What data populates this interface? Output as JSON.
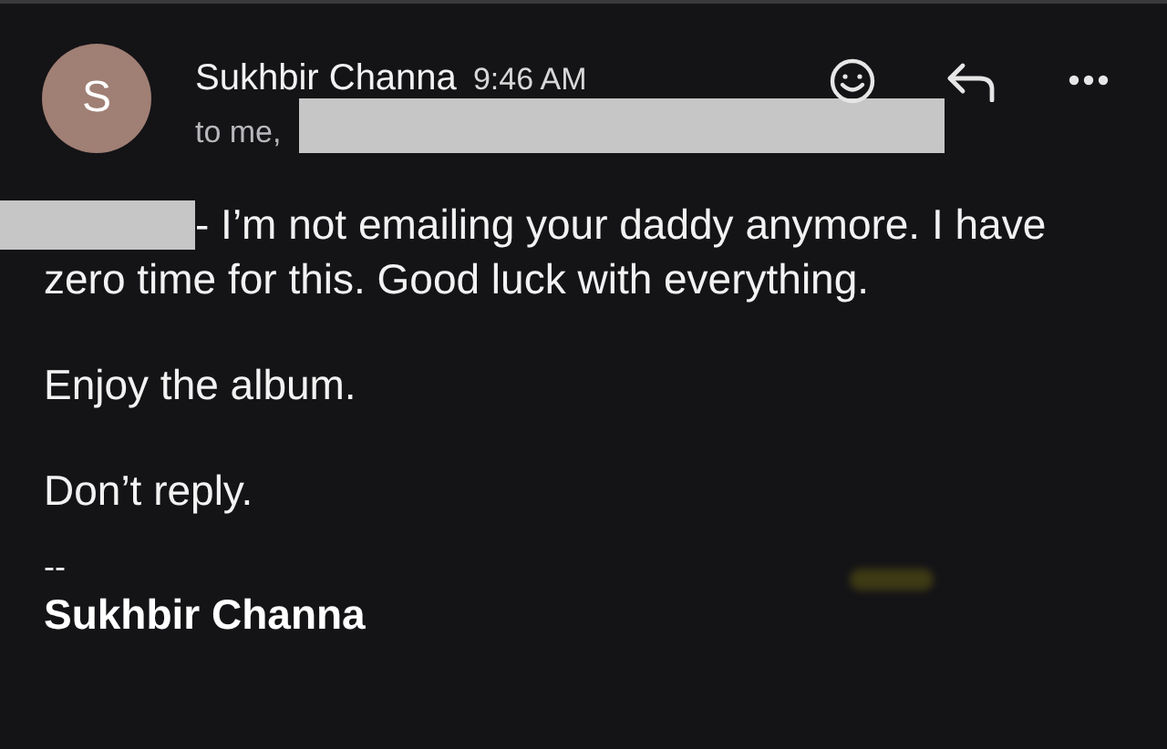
{
  "header": {
    "avatar_letter": "S",
    "sender": "Sukhbir Channa",
    "time": "9:46 AM",
    "recipients": "to me,"
  },
  "body": {
    "first_paragraph_lines": [
      "- I’m not emailing your daddy anymore. I have",
      "zero time for this. Good luck with everything."
    ],
    "paragraphs": [
      "Enjoy the album.",
      "Don’t reply."
    ],
    "signature": {
      "separator": "--",
      "name": "Sukhbir Channa"
    }
  }
}
